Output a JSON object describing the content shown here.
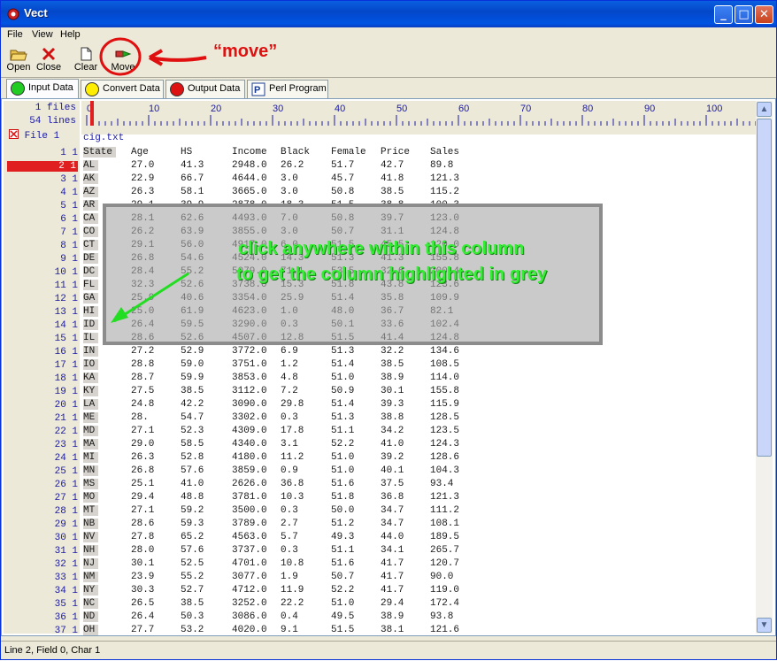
{
  "window": {
    "title": "Vect",
    "minimize": "_",
    "maximize": "□",
    "close": "✕"
  },
  "menu": {
    "file": "File",
    "view": "View",
    "help": "Help"
  },
  "toolbar": {
    "open_label": "Open",
    "close_label": "Close",
    "clear_label": "Clear",
    "move_label": "Move"
  },
  "tabs": {
    "input": "Input Data",
    "convert": "Convert Data",
    "output": "Output Data",
    "perl": "Perl Program"
  },
  "tab_colors": {
    "input": "#22cc22",
    "convert": "#ffee00",
    "output": "#dd1111"
  },
  "summary": {
    "files": "1 files",
    "lines": "54 lines",
    "file_label": "File 1",
    "filename": "cig.txt"
  },
  "ruler": {
    "ticks": [
      "0",
      "10",
      "20",
      "30",
      "40",
      "50",
      "60",
      "70",
      "80",
      "90",
      "100"
    ]
  },
  "columns": [
    "State",
    "Age",
    "HS",
    "Income",
    "Black",
    "Female",
    "Price",
    "Sales"
  ],
  "rows": [
    [
      "AL",
      "27.0",
      "41.3",
      "2948.0",
      "26.2",
      "51.7",
      "42.7",
      "89.8"
    ],
    [
      "AK",
      "22.9",
      "66.7",
      "4644.0",
      "3.0",
      "45.7",
      "41.8",
      "121.3"
    ],
    [
      "AZ",
      "26.3",
      "58.1",
      "3665.0",
      "3.0",
      "50.8",
      "38.5",
      "115.2"
    ],
    [
      "AR",
      "29.1",
      "39.9",
      "2878.0",
      "18.3",
      "51.5",
      "38.8",
      "100.3"
    ],
    [
      "CA",
      "28.1",
      "62.6",
      "4493.0",
      "7.0",
      "50.8",
      "39.7",
      "123.0"
    ],
    [
      "CO",
      "26.2",
      "63.9",
      "3855.0",
      "3.0",
      "50.7",
      "31.1",
      "124.8"
    ],
    [
      "CT",
      "29.1",
      "56.0",
      "4917.0",
      "6.0",
      "51.5",
      "45.5",
      "120.0"
    ],
    [
      "DE",
      "26.8",
      "54.6",
      "4524.0",
      "14.3",
      "51.3",
      "41.3",
      "155.8"
    ],
    [
      "DC",
      "28.4",
      "55.2",
      "5079.0",
      "71.1",
      "53.5",
      "32.6",
      "200.4"
    ],
    [
      "FL",
      "32.3",
      "52.6",
      "3738.0",
      "15.3",
      "51.8",
      "43.8",
      "123.6"
    ],
    [
      "GA",
      "25.9",
      "40.6",
      "3354.0",
      "25.9",
      "51.4",
      "35.8",
      "109.9"
    ],
    [
      "HI",
      "25.0",
      "61.9",
      "4623.0",
      "1.0",
      "48.0",
      "36.7",
      "82.1"
    ],
    [
      "ID",
      "26.4",
      "59.5",
      "3290.0",
      "0.3",
      "50.1",
      "33.6",
      "102.4"
    ],
    [
      "IL",
      "28.6",
      "52.6",
      "4507.0",
      "12.8",
      "51.5",
      "41.4",
      "124.8"
    ],
    [
      "IN",
      "27.2",
      "52.9",
      "3772.0",
      "6.9",
      "51.3",
      "32.2",
      "134.6"
    ],
    [
      "IO",
      "28.8",
      "59.0",
      "3751.0",
      "1.2",
      "51.4",
      "38.5",
      "108.5"
    ],
    [
      "KA",
      "28.7",
      "59.9",
      "3853.0",
      "4.8",
      "51.0",
      "38.9",
      "114.0"
    ],
    [
      "KY",
      "27.5",
      "38.5",
      "3112.0",
      "7.2",
      "50.9",
      "30.1",
      "155.8"
    ],
    [
      "LA",
      "24.8",
      "42.2",
      "3090.0",
      "29.8",
      "51.4",
      "39.3",
      "115.9"
    ],
    [
      "ME",
      "28.",
      "54.7",
      "3302.0",
      "0.3",
      "51.3",
      "38.8",
      "128.5"
    ],
    [
      "MD",
      "27.1",
      "52.3",
      "4309.0",
      "17.8",
      "51.1",
      "34.2",
      "123.5"
    ],
    [
      "MA",
      "29.0",
      "58.5",
      "4340.0",
      "3.1",
      "52.2",
      "41.0",
      "124.3"
    ],
    [
      "MI",
      "26.3",
      "52.8",
      "4180.0",
      "11.2",
      "51.0",
      "39.2",
      "128.6"
    ],
    [
      "MN",
      "26.8",
      "57.6",
      "3859.0",
      "0.9",
      "51.0",
      "40.1",
      "104.3"
    ],
    [
      "MS",
      "25.1",
      "41.0",
      "2626.0",
      "36.8",
      "51.6",
      "37.5",
      "93.4"
    ],
    [
      "MO",
      "29.4",
      "48.8",
      "3781.0",
      "10.3",
      "51.8",
      "36.8",
      "121.3"
    ],
    [
      "MT",
      "27.1",
      "59.2",
      "3500.0",
      "0.3",
      "50.0",
      "34.7",
      "111.2"
    ],
    [
      "NB",
      "28.6",
      "59.3",
      "3789.0",
      "2.7",
      "51.2",
      "34.7",
      "108.1"
    ],
    [
      "NV",
      "27.8",
      "65.2",
      "4563.0",
      "5.7",
      "49.3",
      "44.0",
      "189.5"
    ],
    [
      "NH",
      "28.0",
      "57.6",
      "3737.0",
      "0.3",
      "51.1",
      "34.1",
      "265.7"
    ],
    [
      "NJ",
      "30.1",
      "52.5",
      "4701.0",
      "10.8",
      "51.6",
      "41.7",
      "120.7"
    ],
    [
      "NM",
      "23.9",
      "55.2",
      "3077.0",
      "1.9",
      "50.7",
      "41.7",
      "90.0"
    ],
    [
      "NY",
      "30.3",
      "52.7",
      "4712.0",
      "11.9",
      "52.2",
      "41.7",
      "119.0"
    ],
    [
      "NC",
      "26.5",
      "38.5",
      "3252.0",
      "22.2",
      "51.0",
      "29.4",
      "172.4"
    ],
    [
      "ND",
      "26.4",
      "50.3",
      "3086.0",
      "0.4",
      "49.5",
      "38.9",
      "93.8"
    ],
    [
      "OH",
      "27.7",
      "53.2",
      "4020.0",
      "9.1",
      "51.5",
      "38.1",
      "121.6"
    ]
  ],
  "line_numbers": [
    "1 1",
    "2 1",
    "3 1",
    "4 1",
    "5 1",
    "6 1",
    "7 1",
    "8 1",
    "9 1",
    "10 1",
    "11 1",
    "12 1",
    "13 1",
    "14 1",
    "15 1",
    "16 1",
    "17 1",
    "18 1",
    "19 1",
    "20 1",
    "21 1",
    "22 1",
    "23 1",
    "24 1",
    "25 1",
    "26 1",
    "27 1",
    "28 1",
    "29 1",
    "30 1",
    "31 1",
    "32 1",
    "33 1",
    "34 1",
    "35 1",
    "36 1",
    "37 1"
  ],
  "selected_line": "2 1",
  "annotations": {
    "move": "“move”",
    "line1": "click anywhere within this column",
    "line2": "to get the column highlighted in grey"
  },
  "status": "Line 2, Field 0, Char 1"
}
